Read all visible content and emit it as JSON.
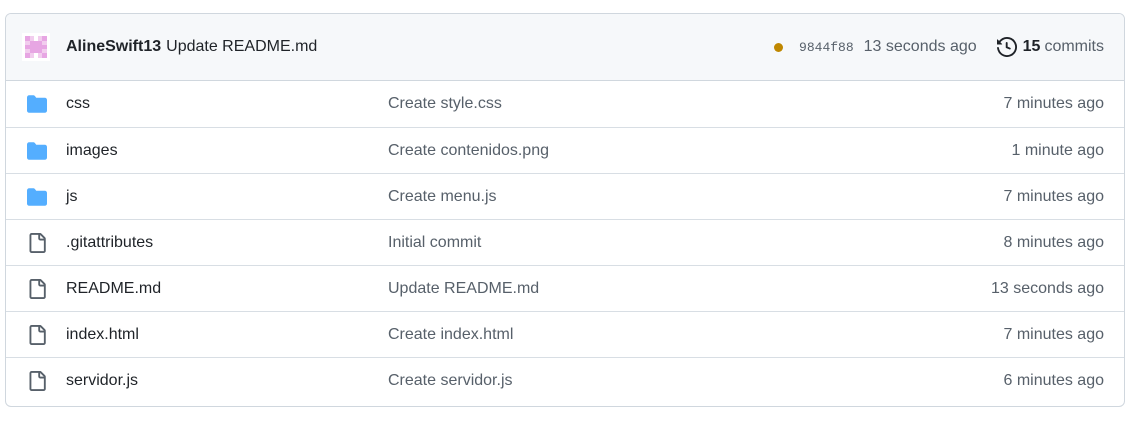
{
  "header": {
    "author": "AlineSwift13",
    "message": "Update README.md",
    "sha": "9844f88",
    "time": "13 seconds ago",
    "commit_count": "15",
    "commits_label": "commits",
    "status_color": "#bf8700"
  },
  "files": [
    {
      "name": "css",
      "type": "folder",
      "message": "Create style.css",
      "time": "7 minutes ago"
    },
    {
      "name": "images",
      "type": "folder",
      "message": "Create contenidos.png",
      "time": "1 minute ago"
    },
    {
      "name": "js",
      "type": "folder",
      "message": "Create menu.js",
      "time": "7 minutes ago"
    },
    {
      "name": ".gitattributes",
      "type": "file",
      "message": "Initial commit",
      "time": "8 minutes ago"
    },
    {
      "name": "README.md",
      "type": "file",
      "message": "Update README.md",
      "time": "13 seconds ago"
    },
    {
      "name": "index.html",
      "type": "file",
      "message": "Create index.html",
      "time": "7 minutes ago"
    },
    {
      "name": "servidor.js",
      "type": "file",
      "message": "Create servidor.js",
      "time": "6 minutes ago"
    }
  ],
  "colors": {
    "folder": "#54aeff",
    "file": "#57606a"
  }
}
